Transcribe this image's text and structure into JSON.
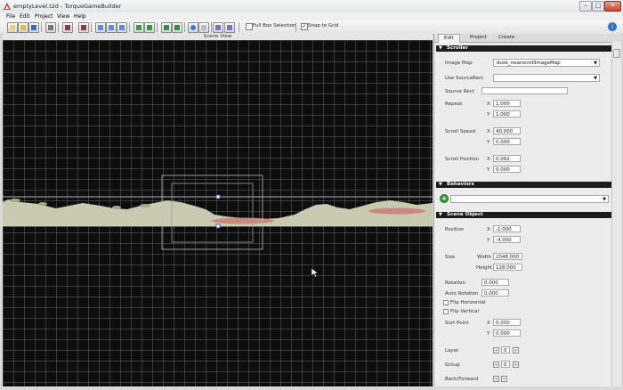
{
  "window": {
    "title": "emptyLevel.t2d - TorqueGameBuilder"
  },
  "window_controls": {
    "minimize": "–",
    "maximize": "□",
    "close": "✕"
  },
  "menu": {
    "items": [
      "File",
      "Edit",
      "Project",
      "View",
      "Help"
    ]
  },
  "toolbar": {
    "full_box_selection": {
      "label": "Full Box Selection",
      "checked": false
    },
    "snap_to_grid": {
      "label": "Snap to Grid",
      "checked": true
    },
    "help_label": "i"
  },
  "scene": {
    "header": "Scene View"
  },
  "panel": {
    "tabs": [
      "Edit",
      "Project",
      "Create"
    ],
    "active_tab": "Edit",
    "scroller": {
      "title": "Scroller",
      "image_map_label": "Image Map",
      "image_map_value": "dusk_nearscrollImageMap",
      "use_source_rect_label": "Use SourceRect",
      "use_source_rect_value": "",
      "source_rect_label": "Source Rect",
      "source_rect_value": "",
      "repeat_label": "Repeat",
      "repeat_x": "1.000",
      "repeat_y": "1.000",
      "scroll_speed_label": "Scroll Speed",
      "scroll_speed_x": "40.000",
      "scroll_speed_y": "0.000",
      "scroll_position_label": "Scroll Position",
      "scroll_position_x": "0.062",
      "scroll_position_y": "0.000",
      "x_label": "X",
      "y_label": "Y"
    },
    "behaviors": {
      "title": "Behaviors",
      "add_label": "+",
      "dropdown_value": ""
    },
    "scene_object": {
      "title": "Scene Object",
      "position_label": "Position",
      "position_x": "-1.000",
      "position_y": "-4.000",
      "size_label": "Size",
      "width_label": "Width",
      "width_value": "2048.000",
      "height_label": "Height",
      "height_value": "128.000",
      "rotation_label": "Rotation",
      "rotation_value": "0.000",
      "auto_rotation_label": "Auto Rotation",
      "auto_rotation_value": "0.000",
      "flip_horizontal_label": "Flip Horizontal",
      "flip_vertical_label": "Flip Vertical",
      "sort_point_label": "Sort Point",
      "sort_point_x": "0.000",
      "sort_point_y": "0.000",
      "layer_label": "Layer",
      "layer_value": "0",
      "group_label": "Group",
      "group_value": "0",
      "back_forward_label": "Back/Forward",
      "x_label": "X",
      "y_label": "Y",
      "dec_label": "«",
      "inc_label": "»"
    }
  }
}
